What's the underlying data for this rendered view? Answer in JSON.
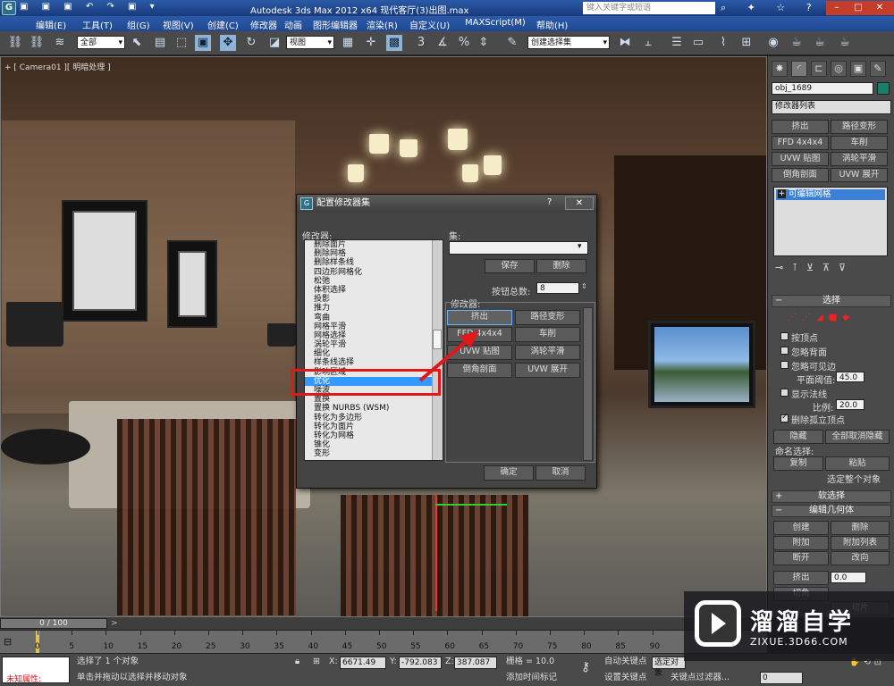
{
  "titlebar": {
    "app_logo": "G",
    "quick_access": "▣ ▣ ▣ ↶ ↷ ▣ ▾",
    "title": "Autodesk 3ds Max  2012 x64      现代客厅(3)出图.max",
    "search_placeholder": "键入关键字或短语",
    "icons": "⌕ ✦ ☆ ?",
    "minimize": "–",
    "maximize": "□",
    "close": "✕"
  },
  "menu": [
    "编辑(E)",
    "工具(T)",
    "组(G)",
    "视图(V)",
    "创建(C)",
    "修改器",
    "动画",
    "图形编辑器",
    "渲染(R)",
    "自定义(U)",
    "MAXScript(M)",
    "帮助(H)"
  ],
  "toolbar": {
    "filter_value": "全部",
    "refcoord_value": "视图",
    "named_selection_value": "创建选择集"
  },
  "viewport": {
    "label": "+ [ Camera01 ][ 明暗处理 ]"
  },
  "dialog": {
    "title": "配置修改器集",
    "help": "?",
    "close": "✕",
    "modifiers_label": "修改器:",
    "modifier_list": [
      "删除面片",
      "删除网格",
      "删除样条线",
      "四边形网格化",
      "松弛",
      "体积选择",
      "投影",
      "推力",
      "弯曲",
      "网格平滑",
      "网格选择",
      "涡轮平滑",
      "细化",
      "样条线选择",
      "影响区域",
      "优化",
      "噪波",
      "置换",
      "置换 NURBS (WSM)",
      "转化为多边形",
      "转化为面片",
      "转化为网格",
      "锥化",
      "变形"
    ],
    "selected_modifier": "优化",
    "sets_label": "集:",
    "sets_value": "",
    "save_button": "保存",
    "delete_button": "删除",
    "total_buttons_label": "按钮总数:",
    "total_buttons_value": "8",
    "modifiers_group_label": "修改器:",
    "buttons": [
      "挤出",
      "路径变形",
      "FFD 4x4x4",
      "车削",
      "UVW 贴图",
      "涡轮平滑",
      "倒角剖面",
      "UVW 展开"
    ],
    "ok_button": "确定",
    "cancel_button": "取消"
  },
  "command_panel": {
    "object_name": "obj_1689",
    "object_color": "#18806a",
    "modifier_list_label": "修改器列表",
    "quick_buttons": [
      "挤出",
      "路径变形",
      "FFD 4x4x4",
      "车削",
      "UVW 贴图",
      "涡轮平滑",
      "倒角剖面",
      "UVW 展开"
    ],
    "stack_item": "可编辑网格",
    "selection_rollout": "选择",
    "options": [
      {
        "label": "按顶点",
        "checked": false
      },
      {
        "label": "忽略背面",
        "checked": false
      },
      {
        "label": "忽略可见边",
        "checked": false
      }
    ],
    "planar_threshold_label": "平面阈值:",
    "planar_threshold_value": "45.0",
    "show_normals_label": "显示法线",
    "scale_label": "比例:",
    "scale_value": "20.0",
    "delete_isolated_label": "删除孤立顶点",
    "hide_button": "隐藏",
    "unhide_all_button": "全部取消隐藏",
    "named_selections_label": "命名选择:",
    "copy_button": "复制",
    "paste_button": "粘贴",
    "select_whole_label": "选定整个对象",
    "soft_selection_rollout": "软选择",
    "edit_geometry_rollout": "编辑几何体",
    "geom_buttons": [
      "创建",
      "删除",
      "附加",
      "附加列表",
      "断开",
      "改向"
    ],
    "extrude_label": "挤出",
    "extrude_value": "0.0",
    "bevel_label": "切角",
    "slice_button": "切片"
  },
  "timeline": {
    "frame_display": "0 / 100",
    "ticks": [
      "0",
      "5",
      "10",
      "15",
      "20",
      "25",
      "30",
      "35",
      "40",
      "45",
      "50",
      "55",
      "60",
      "65",
      "70",
      "75",
      "80",
      "85",
      "90"
    ]
  },
  "status": {
    "unknown_attr": "未知属性: ",
    "selected_text": "选择了 1 个对象",
    "hint_text": "单击并拖动以选择并移动对象",
    "x_label": "X:",
    "x_value": "6671.49",
    "y_label": "Y:",
    "y_value": "-792.083",
    "z_label": "Z:",
    "z_value": "387.087",
    "grid_text": "栅格 = 10.0",
    "add_time_tag": "添加时间标记",
    "auto_key": "自动关键点",
    "set_key": "设置关键点",
    "selected_filter": "选定对象",
    "key_filters": "关键点过滤器...",
    "frame_value": "0"
  },
  "watermark": {
    "title": "溜溜自学",
    "url": "ZIXUE.3D66.COM"
  }
}
